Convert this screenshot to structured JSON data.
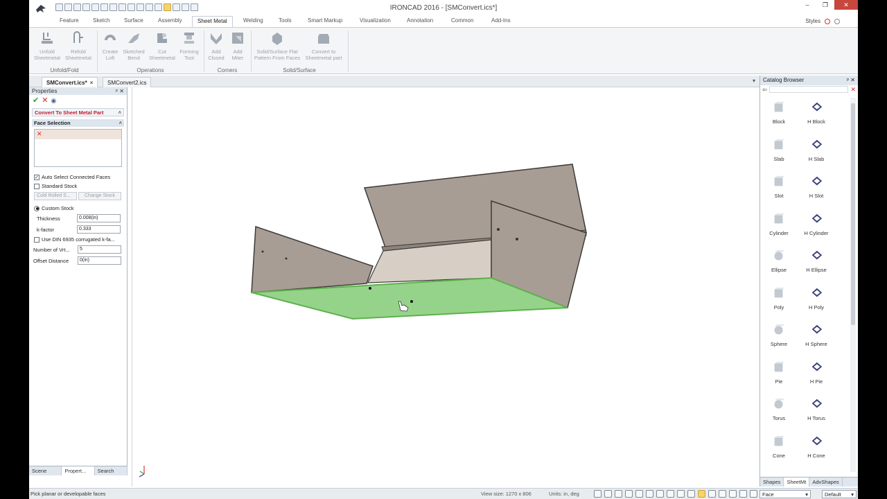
{
  "window": {
    "title": "IRONCAD 2016 - [SMConvert.ics*]",
    "controls": {
      "minimize": "–",
      "restore": "❐",
      "close": "✕"
    }
  },
  "ribbon_tabs": [
    "Feature",
    "Sketch",
    "Surface",
    "Assembly",
    "Sheet Metal",
    "Welding",
    "Tools",
    "Smart Markup",
    "Visualization",
    "Annotation",
    "Common",
    "Add-Ins"
  ],
  "active_ribbon_tab": "Sheet Metal",
  "styles_label": "Styles",
  "ribbon": {
    "buttons": [
      {
        "line1": "Unfold",
        "line2": "Sheetmetal",
        "icon": "unfold-icon"
      },
      {
        "line1": "Refold",
        "line2": "Sheetmetal",
        "icon": "refold-icon"
      },
      {
        "line1": "Create",
        "line2": "Loft",
        "icon": "loft-icon"
      },
      {
        "line1": "Sketched",
        "line2": "Bend",
        "icon": "bend-icon"
      },
      {
        "line1": "Cut",
        "line2": "Sheetmetal",
        "icon": "cut-icon"
      },
      {
        "line1": "Forming",
        "line2": "Tool",
        "icon": "forming-tool-icon"
      },
      {
        "line1": "Add",
        "line2": "Closed",
        "icon": "closed-corner-icon"
      },
      {
        "line1": "Add",
        "line2": "Miter",
        "icon": "miter-icon"
      },
      {
        "line1": "Solid/Surface Flat",
        "line2": "Pattern From Faces",
        "icon": "flat-pattern-icon"
      },
      {
        "line1": "Convert to",
        "line2": "Sheetmetal part",
        "icon": "convert-icon"
      }
    ],
    "groups": [
      "Unfold/Fold",
      "Operations",
      "Corners",
      "Solid/Surface"
    ]
  },
  "doc_tabs": [
    {
      "label": "SMConvert.ics*",
      "active": true
    },
    {
      "label": "SMConvert2.ics",
      "active": false
    }
  ],
  "properties": {
    "header": "Properties",
    "section_title": "Convert To Sheet Metal Part",
    "face_selection_label": "Face Selection",
    "auto_select_label": "Auto Select Connected Faces",
    "auto_select_checked": true,
    "standard_stock_label": "Standard Stock",
    "standard_stock_checked": false,
    "cold_rolled_label": "Cold Rolled S...",
    "change_stock_label": "Change Stock",
    "custom_stock_label": "Custom Stock",
    "thickness_label": "Thickness",
    "thickness_value": "0.008(in)",
    "kfactor_label": "k-factor",
    "kfactor_value": "0.333",
    "din_label": "Use DIN 6935 corrugated k-fa...",
    "din_checked": false,
    "vertices_label": "Number of Vrt...",
    "vertices_value": "5",
    "offset_label": "Offset Distance",
    "offset_value": "0(in)",
    "bottom_tabs": [
      "Scene",
      "Propert...",
      "Search"
    ],
    "active_bottom_tab": "Propert..."
  },
  "catalog": {
    "header": "Catalog Browser",
    "items": [
      {
        "label": "Block",
        "icon": "block-icon"
      },
      {
        "label": "H Block",
        "icon": "h-block-icon"
      },
      {
        "label": "Slab",
        "icon": "slab-icon"
      },
      {
        "label": "H Slab",
        "icon": "h-slab-icon"
      },
      {
        "label": "Slot",
        "icon": "slot-icon"
      },
      {
        "label": "H Slot",
        "icon": "h-slot-icon"
      },
      {
        "label": "Cylinder",
        "icon": "cylinder-icon"
      },
      {
        "label": "H Cylinder",
        "icon": "h-cylinder-icon"
      },
      {
        "label": "Ellipse",
        "icon": "ellipse-icon"
      },
      {
        "label": "H Ellipse",
        "icon": "h-ellipse-icon"
      },
      {
        "label": "Poly",
        "icon": "poly-icon"
      },
      {
        "label": "H Poly",
        "icon": "h-poly-icon"
      },
      {
        "label": "Sphere",
        "icon": "sphere-icon"
      },
      {
        "label": "H Sphere",
        "icon": "h-sphere-icon"
      },
      {
        "label": "Pie",
        "icon": "pie-icon"
      },
      {
        "label": "H Pie",
        "icon": "h-pie-icon"
      },
      {
        "label": "Torus",
        "icon": "torus-icon"
      },
      {
        "label": "H Torus",
        "icon": "h-torus-icon"
      },
      {
        "label": "Cone",
        "icon": "cone-icon"
      },
      {
        "label": "H Cone",
        "icon": "h-cone-icon"
      }
    ],
    "bottom_tabs": [
      "Shapes",
      "SheetMt",
      "AdvShapes"
    ],
    "active_bottom_tab": "SheetMt"
  },
  "status": {
    "message": "Pick planar or developable faces",
    "view_size": "View size: 1270 x  806",
    "units": "Units: in, deg",
    "filter_value": "Face",
    "display_value": "Default"
  },
  "colors": {
    "selected_face": "#96d38a",
    "face_dark": "#a79d94",
    "face_light": "#d7cfc6",
    "close_button": "#c7463d",
    "accent_red": "#c0192e"
  }
}
